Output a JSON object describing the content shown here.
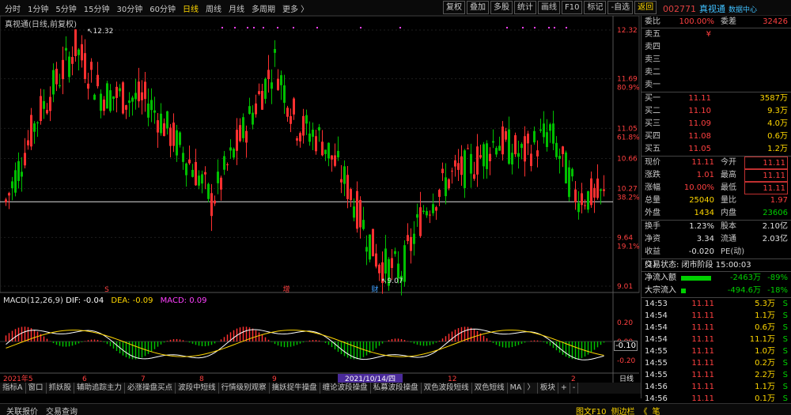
{
  "topbar": {
    "periods": [
      "分时",
      "1分钟",
      "5分钟",
      "15分钟",
      "30分钟",
      "60分钟",
      "日线",
      "周线",
      "月线",
      "多周期",
      "更多 〉"
    ],
    "active_period": "日线",
    "tools": [
      "复权",
      "叠加",
      "多股",
      "统计",
      "画线",
      "F10",
      "标记",
      "-自选",
      "返回"
    ],
    "stock_code": "002771",
    "stock_name": "真视通",
    "data_center": "数据中心"
  },
  "chart": {
    "title": "真视通(日线,前复权)",
    "y_labels": [
      {
        "v": "12.32",
        "pct": ""
      },
      {
        "v": "11.69",
        "pct": "80.9%"
      },
      {
        "v": "11.05",
        "pct": "61.8%"
      },
      {
        "v": "10.66",
        "pct": ""
      },
      {
        "v": "10.27",
        "pct": "38.2%"
      },
      {
        "v": "9.64",
        "pct": "19.1%"
      },
      {
        "v": "9.01",
        "pct": ""
      }
    ],
    "high_label": "12.32",
    "low_label": "9.07",
    "markers": [
      "S",
      "增",
      "财"
    ],
    "macd_title": {
      "name": "MACD(12,26,9)",
      "dif": "DIF: -0.04",
      "dea": "DEA: -0.09",
      "macd": "MACD: 0.09"
    },
    "macd_axis": [
      "0.20",
      "0.00",
      "-0.20"
    ],
    "macd_badge": "-0.10",
    "x_labels": [
      "2021年5",
      "6",
      "7",
      "8",
      "9",
      "10",
      "12",
      "2",
      "日线"
    ],
    "date_cursor": "2021/10/14/四"
  },
  "quote": {
    "webi": {
      "label": "委比",
      "v": "100.00%",
      "k2": "委差",
      "v2": "32426"
    },
    "asks": [
      {
        "name": "卖五",
        "price": "¥",
        "vol": ""
      },
      {
        "name": "卖四",
        "price": "",
        "vol": ""
      },
      {
        "name": "卖三",
        "price": "",
        "vol": ""
      },
      {
        "name": "卖二",
        "price": "",
        "vol": ""
      },
      {
        "name": "卖一",
        "price": "",
        "vol": ""
      }
    ],
    "bids": [
      {
        "name": "买一",
        "price": "11.11",
        "vol": "3587万"
      },
      {
        "name": "买二",
        "price": "11.10",
        "vol": "9.3万"
      },
      {
        "name": "买三",
        "price": "11.09",
        "vol": "4.0万"
      },
      {
        "name": "买四",
        "price": "11.08",
        "vol": "0.6万"
      },
      {
        "name": "买五",
        "price": "11.05",
        "vol": "1.2万"
      }
    ],
    "stats": [
      {
        "k": "现价",
        "v": "11.11",
        "k2": "今开",
        "v2": "11.11"
      },
      {
        "k": "涨跌",
        "v": "1.01",
        "k2": "最高",
        "v2": "11.11"
      },
      {
        "k": "涨幅",
        "v": "10.00%",
        "k2": "最低",
        "v2": "11.11"
      },
      {
        "k": "总量",
        "v": "25040",
        "k2": "量比",
        "v2": "1.97"
      },
      {
        "k": "外盘",
        "v": "1434",
        "k2": "内盘",
        "v2": "23606"
      }
    ],
    "fund": [
      {
        "k": "换手",
        "v": "1.23%",
        "k2": "股本",
        "v2": "2.10亿"
      },
      {
        "k": "净资",
        "v": "3.34",
        "k2": "流通",
        "v2": "2.03亿"
      },
      {
        "k": "收益(1)",
        "v": "-0.020",
        "k2": "PE(动)",
        "v2": ""
      }
    ],
    "trade_status": "交易状态: 闭市阶段 15:00:03",
    "flow": [
      {
        "k": "净流入额",
        "v": "-2463万",
        "pct": "-89%"
      },
      {
        "k": "大宗流入",
        "v": "-494.6万",
        "pct": "-18%"
      }
    ],
    "ticks": [
      {
        "t": "14:53",
        "p": "11.11",
        "v": "5.3万",
        "f": "S"
      },
      {
        "t": "14:54",
        "p": "11.11",
        "v": "1.1万",
        "f": "S"
      },
      {
        "t": "14:54",
        "p": "11.11",
        "v": "0.6万",
        "f": "S"
      },
      {
        "t": "14:54",
        "p": "11.11",
        "v": "11.1万",
        "f": "S"
      },
      {
        "t": "14:55",
        "p": "11.11",
        "v": "1.0万",
        "f": "S"
      },
      {
        "t": "14:55",
        "p": "11.11",
        "v": "0.2万",
        "f": "S"
      },
      {
        "t": "14:55",
        "p": "11.11",
        "v": "2.2万",
        "f": "S"
      },
      {
        "t": "14:56",
        "p": "11.11",
        "v": "1.1万",
        "f": "S"
      },
      {
        "t": "14:56",
        "p": "11.11",
        "v": "0.1万",
        "f": "S"
      }
    ]
  },
  "tabs": [
    "指标A",
    "窗口",
    "抓妖股",
    "辅助追踪主力",
    "必涨操盘买点",
    "波段中短线",
    "行情级别观察",
    "擒妖捉牛操盘",
    "缠论波段操盘",
    "私募波段操盘",
    "双色波段短线",
    "双色短线",
    "MA",
    "〉",
    "板块",
    "+",
    "-"
  ],
  "status": {
    "left": [
      "关联报价",
      "交易查询"
    ],
    "right": [
      "图文F10",
      "侧边栏",
      "《",
      "笔"
    ]
  },
  "colors": {
    "up": "#ff3030",
    "down": "#00c000",
    "bg": "#000000",
    "accent": "#ffd700"
  }
}
